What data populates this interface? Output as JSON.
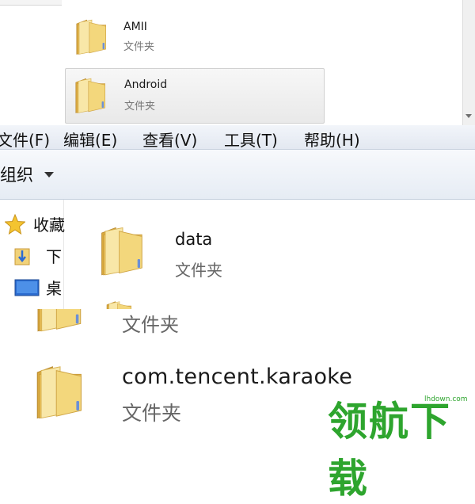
{
  "panel1": {
    "items": [
      {
        "name": "AMII",
        "type": "文件夹"
      },
      {
        "name": "Android",
        "type": "文件夹",
        "selected": true
      }
    ]
  },
  "menubar": {
    "items": [
      "文件(F)",
      "编辑(E)",
      "查看(V)",
      "工具(T)",
      "帮助(H)"
    ]
  },
  "toolbar": {
    "organize_label": "组织"
  },
  "navpane": {
    "items": [
      {
        "label": "收藏",
        "icon": "star-icon"
      },
      {
        "label": "下",
        "icon": "download-folder-icon"
      },
      {
        "label": "桌",
        "icon": "desktop-icon"
      }
    ]
  },
  "content": {
    "items": [
      {
        "name": "data",
        "type": "文件夹"
      }
    ]
  },
  "panel3": {
    "prev_type": "文件夹",
    "item": {
      "name": "com.tencent.karaoke",
      "type": "文件夹"
    }
  },
  "watermark": {
    "text": "领航下载",
    "url": "lhdown.com"
  },
  "colors": {
    "folder_body": "#f6d77a",
    "folder_back": "#e8b94a",
    "watermark": "#2ea52e",
    "menubar_bg": "#e8edf5"
  }
}
